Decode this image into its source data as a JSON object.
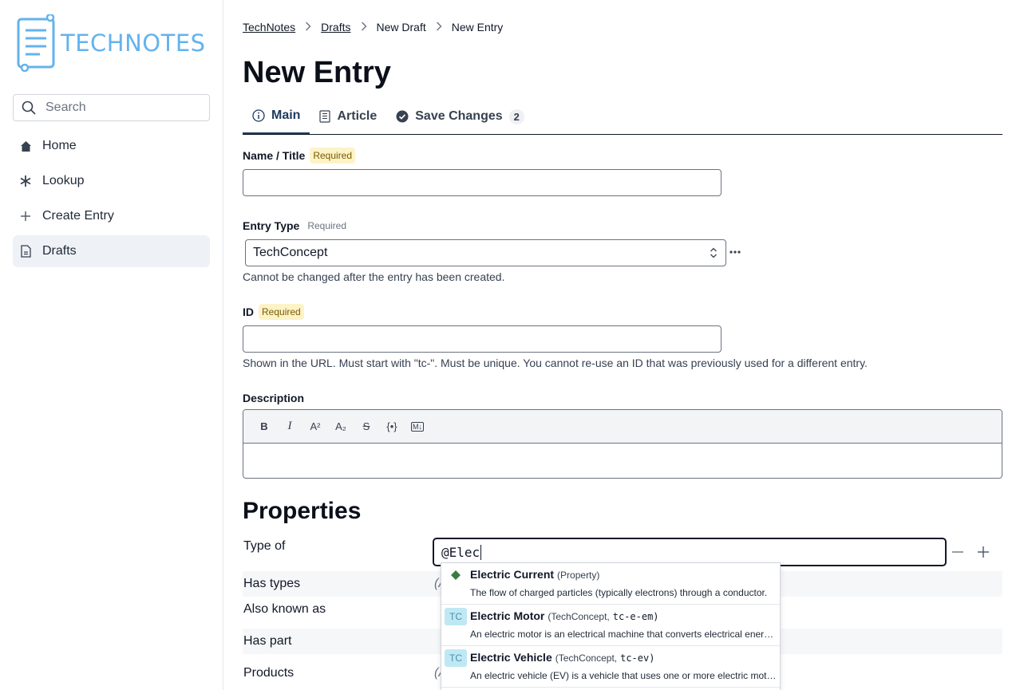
{
  "app": {
    "logo_text": "TECHNOTES"
  },
  "sidebar": {
    "search_placeholder": "Search",
    "items": [
      {
        "label": "Home",
        "icon": "home-icon"
      },
      {
        "label": "Lookup",
        "icon": "asterisk-icon"
      },
      {
        "label": "Create Entry",
        "icon": "plus-icon"
      },
      {
        "label": "Drafts",
        "icon": "document-icon",
        "active": true
      }
    ]
  },
  "breadcrumb": [
    "TechNotes",
    "Drafts",
    "New Draft",
    "New Entry"
  ],
  "page_title": "New Entry",
  "tabs": [
    {
      "label": "Main",
      "icon": "info-icon",
      "active": true
    },
    {
      "label": "Article",
      "icon": "article-icon"
    },
    {
      "label": "Save Changes",
      "icon": "check-circle-icon",
      "badge": "2"
    }
  ],
  "form": {
    "name_label": "Name / Title",
    "name_required": "Required",
    "name_value": "",
    "type_label": "Entry Type",
    "type_required": "Required",
    "type_value": "TechConcept",
    "type_help": "Cannot be changed after the entry has been created.",
    "id_label": "ID",
    "id_required": "Required",
    "id_value": "",
    "id_help": "Shown in the URL. Must start with \"tc-\". Must be unique. You cannot re-use an ID that was previously used for a different entry.",
    "description_label": "Description",
    "toolbar": [
      "B",
      "I",
      "A²",
      "A₂",
      "S",
      "{•}",
      "M↓"
    ]
  },
  "properties": {
    "title": "Properties",
    "rows": [
      {
        "label": "Type of"
      },
      {
        "label": "Has types",
        "value": "(A"
      },
      {
        "label": "Also known as"
      },
      {
        "label": "Has part"
      },
      {
        "label": "Products",
        "value": "(A"
      }
    ],
    "type_of_input": "@Elec"
  },
  "autocomplete": [
    {
      "name": "Electric Current",
      "meta": "(Property)",
      "id": "",
      "icon": "diamond-icon",
      "description": "The flow of charged particles (typically electrons) through a conductor."
    },
    {
      "name": "Electric Motor",
      "meta": "(TechConcept,",
      "id": "tc-e-em)",
      "icon": "TC",
      "description": "An electric motor is an electrical machine that converts electrical energy into mechanical energy."
    },
    {
      "name": "Electric Vehicle",
      "meta": "(TechConcept,",
      "id": "tc-ev)",
      "icon": "TC",
      "description": "An electric vehicle (EV) is a vehicle that uses one or more electric motors for propulsion."
    }
  ],
  "colors": {
    "accent": "#1e3a5f",
    "logo": "#63b3ed",
    "required_bg": "#fdf3c7",
    "tc_badge": "#bfe8f5",
    "property_diamond": "#3a7d44"
  }
}
